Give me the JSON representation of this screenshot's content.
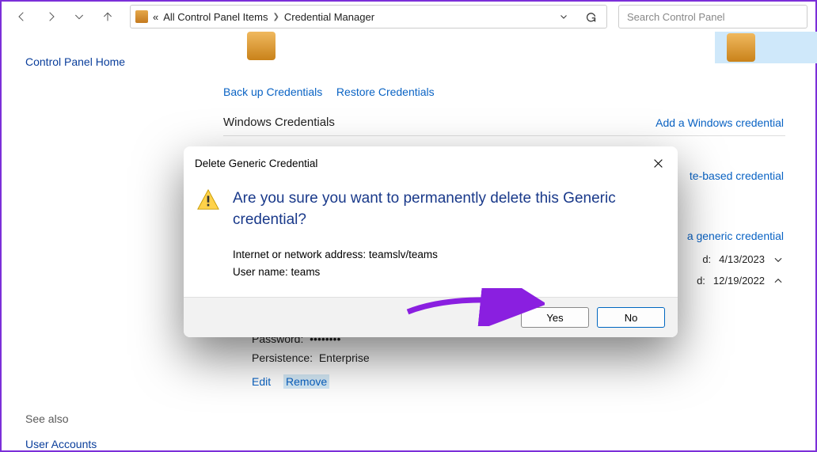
{
  "toolbar": {
    "breadcrumb_prefix": "«",
    "breadcrumb1": "All Control Panel Items",
    "breadcrumb2": "Credential Manager"
  },
  "search": {
    "placeholder": "Search Control Panel"
  },
  "sidebar": {
    "home": "Control Panel Home",
    "see_also": "See also",
    "user_accounts": "User Accounts"
  },
  "links": {
    "backup": "Back up Credentials",
    "restore": "Restore Credentials"
  },
  "sections": {
    "windows": {
      "title": "Windows Credentials",
      "add": "Add a Windows credential"
    },
    "cert": {
      "add_suffix": "te-based credential"
    },
    "generic": {
      "add_suffix": "a generic credential"
    }
  },
  "rows": {
    "r1": {
      "date_prefix": "d:",
      "date": "4/13/2023"
    },
    "r2": {
      "date_prefix": "d:",
      "date": "12/19/2022"
    }
  },
  "details": {
    "addr_label": "Internet or network address:",
    "addr_value": "teamslv/teams",
    "user_label": "User name:",
    "user_value": "teams",
    "pass_label": "Password:",
    "pass_value": "••••••••",
    "pers_label": "Persistence:",
    "pers_value": "Enterprise",
    "edit": "Edit",
    "remove": "Remove"
  },
  "dialog": {
    "title": "Delete Generic Credential",
    "question": "Are you sure you want to permanently delete this Generic credential?",
    "line1_label": "Internet or network address:",
    "line1_value": "teamslv/teams",
    "line2_label": "User name:",
    "line2_value": "teams",
    "yes": "Yes",
    "no": "No"
  }
}
